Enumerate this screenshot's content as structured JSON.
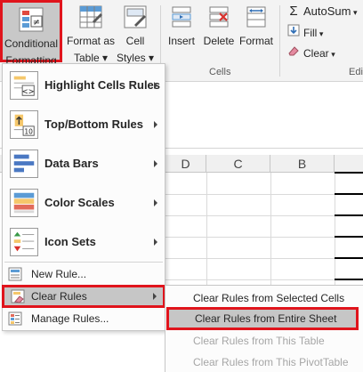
{
  "ribbon": {
    "conditional_formatting": [
      "Conditional",
      "Formatting"
    ],
    "format_as_table": [
      "Format as",
      "Table"
    ],
    "cell_styles": [
      "Cell",
      "Styles"
    ],
    "insert": "Insert",
    "delete": "Delete",
    "format": "Format",
    "cells_group": "Cells",
    "autosum": "AutoSum",
    "fill": "Fill",
    "clear": "Clear",
    "editing_group_partial": "Edi"
  },
  "columns": [
    "D",
    "C",
    "B"
  ],
  "menu": {
    "items": [
      {
        "label": "Highlight Cells Rules",
        "icon": "highlight-cells-icon",
        "has_submenu": true
      },
      {
        "label": "Top/Bottom Rules",
        "icon": "top-bottom-icon",
        "has_submenu": true
      },
      {
        "label": "Data Bars",
        "icon": "data-bars-icon",
        "has_submenu": true
      },
      {
        "label": "Color Scales",
        "icon": "color-scales-icon",
        "has_submenu": true
      },
      {
        "label": "Icon Sets",
        "icon": "icon-sets-icon",
        "has_submenu": true
      }
    ],
    "new_rule": "New Rule...",
    "clear_rules": "Clear Rules",
    "manage_rules": "Manage Rules..."
  },
  "submenu": {
    "items": [
      {
        "label": "Clear Rules from Selected Cells",
        "enabled": true
      },
      {
        "label": "Clear Rules from Entire Sheet",
        "enabled": true,
        "highlighted": true
      },
      {
        "label": "Clear Rules from This Table",
        "enabled": false
      },
      {
        "label": "Clear Rules from This PivotTable",
        "enabled": false
      }
    ]
  },
  "colors": {
    "highlight_border": "#e0141c",
    "highlight_fill": "#c6c6c6",
    "disabled_text": "#a6a6a6"
  }
}
